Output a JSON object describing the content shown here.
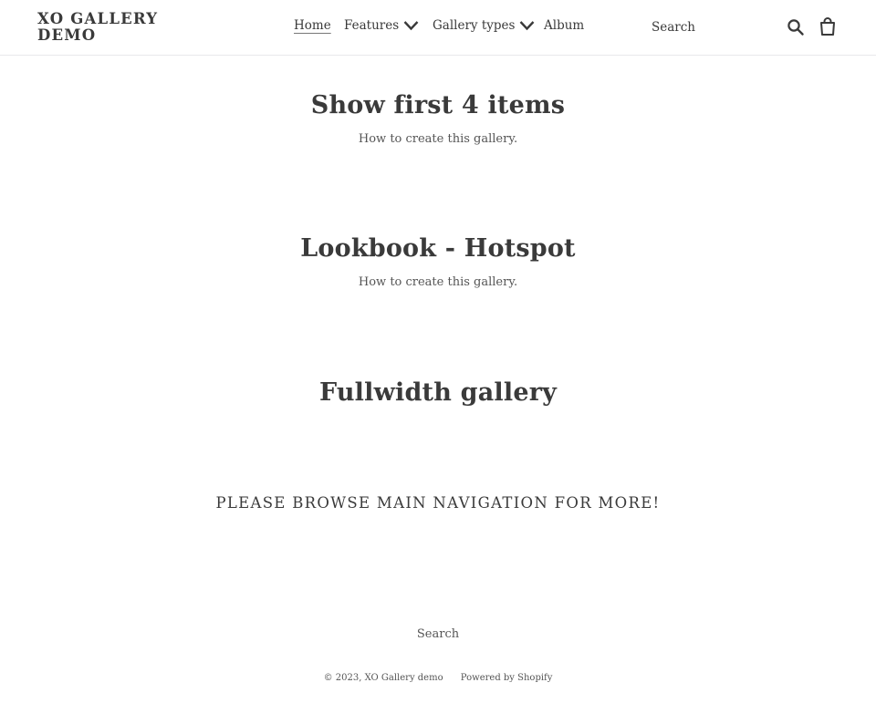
{
  "header": {
    "logo": "XO GALLERY DEMO",
    "nav": {
      "home": "Home",
      "features": "Features",
      "gallery_types": "Gallery types",
      "album": "Album"
    },
    "search_placeholder": "Search",
    "icons": {
      "search": "search-icon",
      "cart": "cart-icon",
      "dropdown": "chevron-down-icon"
    }
  },
  "main": {
    "sections": [
      {
        "title": "Show first 4 items",
        "subtitle": "How to create this gallery."
      },
      {
        "title": "Lookbook - Hotspot",
        "subtitle": "How to create this gallery."
      },
      {
        "title": "Fullwidth gallery"
      }
    ],
    "cta": "PLEASE BROWSE MAIN NAVIGATION FOR MORE!"
  },
  "footer": {
    "search": "Search",
    "copyright": "© 2023, XO Gallery demo",
    "powered": "Powered by Shopify"
  }
}
